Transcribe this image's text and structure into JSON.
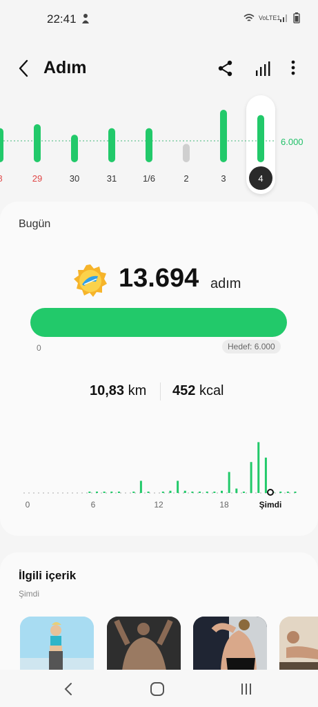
{
  "status": {
    "time": "22:41",
    "network": "VoLTE1"
  },
  "header": {
    "title": "Adım"
  },
  "week": {
    "goal_label": "6.000",
    "days": [
      {
        "label": "8",
        "value": 0.52,
        "color": "#e04545",
        "bar": "#22c96a"
      },
      {
        "label": "29",
        "value": 0.58,
        "color": "#e04545",
        "bar": "#22c96a"
      },
      {
        "label": "30",
        "value": 0.42,
        "color": "#333333",
        "bar": "#22c96a"
      },
      {
        "label": "31",
        "value": 0.52,
        "color": "#333333",
        "bar": "#22c96a"
      },
      {
        "label": "1/6",
        "value": 0.52,
        "color": "#333333",
        "bar": "#22c96a"
      },
      {
        "label": "2",
        "value": 0.28,
        "color": "#333333",
        "bar": "#cfcfcf"
      },
      {
        "label": "3",
        "value": 0.8,
        "color": "#333333",
        "bar": "#22c96a"
      },
      {
        "label": "4",
        "value": 0.72,
        "color": "#ffffff",
        "bar": "#22c96a"
      }
    ]
  },
  "today": {
    "label": "Bugün",
    "steps": "13.694",
    "steps_unit": "adım",
    "progress_start": "0",
    "goal": "Hedef: 6.000",
    "distance": "10,83",
    "distance_unit": "km",
    "calories": "452",
    "calories_unit": "kcal"
  },
  "hourly": {
    "x_labels": [
      "0",
      "6",
      "12",
      "18",
      "Şimdi"
    ],
    "values": [
      0,
      0,
      0,
      0,
      0,
      0,
      0,
      0,
      0,
      0.02,
      0.02,
      0.02,
      0.02,
      0.02,
      0,
      0.02,
      0.22,
      0.02,
      0,
      0.02,
      0.04,
      0.22,
      0.04,
      0.02,
      0.02,
      0.02,
      0.02,
      0.04,
      0.38,
      0.08,
      0.02,
      0.56,
      0.92,
      0.64,
      0.02,
      0.02,
      0.02,
      0.02
    ]
  },
  "related": {
    "title": "İlgili içerik",
    "subtitle": "Şimdi",
    "thumbs": [
      {
        "name": "thumb-runner",
        "bg": "#9fd7f0"
      },
      {
        "name": "thumb-muscle",
        "bg": "#3a3a3a"
      },
      {
        "name": "thumb-back",
        "bg": "#222a3a"
      },
      {
        "name": "thumb-plank",
        "bg": "#d9c9b0"
      }
    ]
  }
}
